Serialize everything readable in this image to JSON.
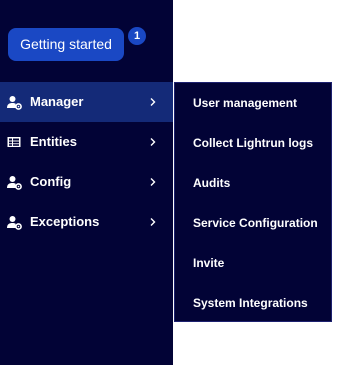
{
  "getting_started": {
    "label": "Getting started",
    "badge": "1"
  },
  "sidebar": {
    "items": [
      {
        "label": "Manager",
        "icon": "user-gear-icon",
        "active": true
      },
      {
        "label": "Entities",
        "icon": "table-icon",
        "active": false
      },
      {
        "label": "Config",
        "icon": "user-gear-icon",
        "active": false
      },
      {
        "label": "Exceptions",
        "icon": "user-gear-icon",
        "active": false
      }
    ]
  },
  "submenu": {
    "items": [
      {
        "label": "User management"
      },
      {
        "label": "Collect Lightrun logs"
      },
      {
        "label": "Audits"
      },
      {
        "label": "Service Configuration"
      },
      {
        "label": "Invite"
      },
      {
        "label": "System Integrations"
      }
    ]
  },
  "colors": {
    "sidebar_bg": "#020336",
    "active_item_bg": "#142a78",
    "button_bg": "#1a48c4",
    "text": "#ffffff"
  }
}
